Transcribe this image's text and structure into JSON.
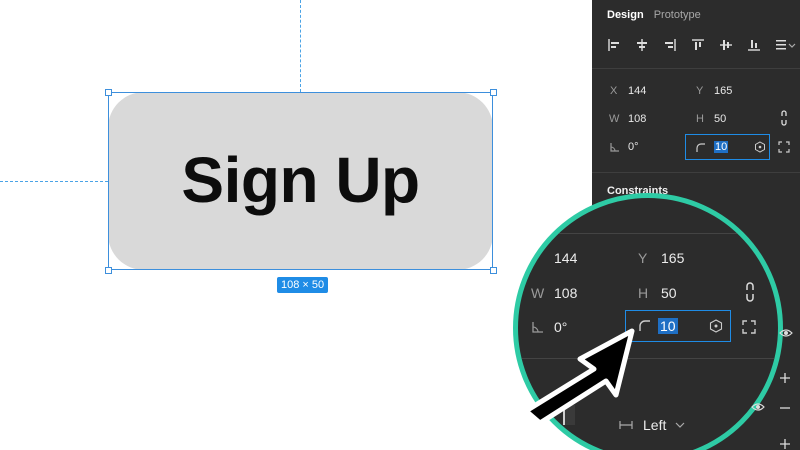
{
  "canvas": {
    "button_label": "Sign Up",
    "size_badge": "108 × 50"
  },
  "panel": {
    "tabs": [
      {
        "label": "Design",
        "active": true
      },
      {
        "label": "Prototype",
        "active": false
      }
    ],
    "align_icons": [
      "align-left-icon",
      "align-center-h-icon",
      "align-right-icon",
      "align-top-icon",
      "align-center-v-icon",
      "align-bottom-icon",
      "distribute-icon"
    ],
    "position": {
      "x_label": "X",
      "x_value": "144",
      "y_label": "Y",
      "y_value": "165",
      "w_label": "W",
      "w_value": "108",
      "h_label": "H",
      "h_value": "50",
      "rotation_value": "0°",
      "radius_value": "10"
    },
    "constraints_title": "Constraints"
  },
  "magnifier": {
    "x_value": "144",
    "y_label": "Y",
    "y_value": "165",
    "w_label": "W",
    "w_value": "108",
    "h_label": "H",
    "h_value": "50",
    "rotation_value": "0°",
    "radius_value": "10",
    "text_align_value": "Left"
  },
  "colors": {
    "accent": "#1f8ce6",
    "magnifier_ring": "#2ecba5",
    "panel_bg": "#2c2c2c"
  }
}
